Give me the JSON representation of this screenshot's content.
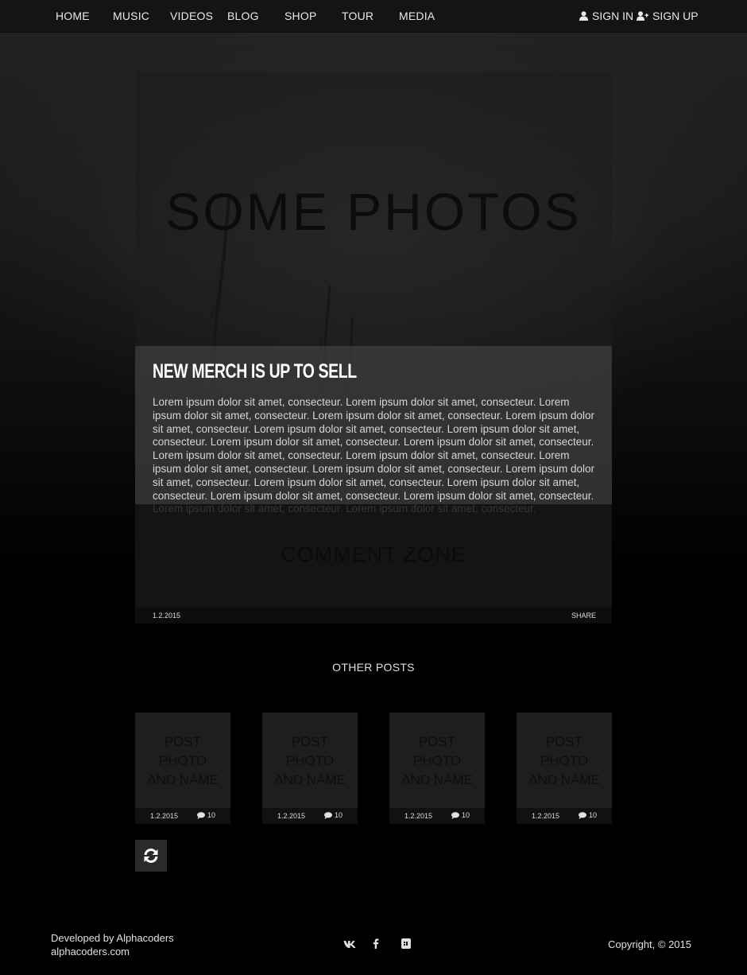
{
  "nav": {
    "items": [
      "HOME",
      "MUSIC",
      "VIDEOS",
      "BLOG",
      "SHOP",
      "TOUR",
      "MEDIA"
    ],
    "sign_in": "SIGN IN",
    "sign_up": "SIGN UP"
  },
  "post": {
    "hero_title": "SOME PHOTOS",
    "title": "NEW MERCH IS UP TO SELL",
    "body": "Lorem ipsum dolor sit amet, consecteur. Lorem ipsum dolor sit amet, consecteur. Lorem ipsum dolor sit amet, consecteur. Lorem ipsum dolor sit amet, consecteur. Lorem ipsum dolor sit amet, consecteur. Lorem ipsum dolor sit amet, consecteur. Lorem ipsum dolor sit amet, consecteur. Lorem ipsum dolor sit amet, consecteur. Lorem ipsum dolor sit amet, consecteur. Lorem ipsum dolor sit amet, consecteur. Lorem ipsum dolor sit amet, consecteur. Lorem ipsum dolor sit amet, consecteur. Lorem ipsum dolor sit amet, consecteur. Lorem ipsum dolor sit amet, consecteur. Lorem ipsum dolor sit amet, consecteur. Lorem ipsum dolor sit amet, consecteur. Lorem ipsum dolor sit amet, consecteur. Lorem ipsum dolor sit amet, consecteur. Lorem ipsum dolor sit amet, consecteur. Lorem ipsum dolor sit amet, consecteur.",
    "comment_zone": "COMMENT ZONE",
    "date": "1.2.2015",
    "share": "SHARE"
  },
  "other_posts": {
    "title": "OTHER POSTS",
    "cards": [
      {
        "placeholder_lines": [
          "POST",
          "PHOTO",
          "AND NAME"
        ],
        "date": "1.2.2015",
        "comments": "10"
      },
      {
        "placeholder_lines": [
          "POST",
          "PHOTO",
          "AND NAME"
        ],
        "date": "1.2.2015",
        "comments": "10"
      },
      {
        "placeholder_lines": [
          "POST",
          "PHOTO",
          "AND NAME"
        ],
        "date": "1.2.2015",
        "comments": "10"
      },
      {
        "placeholder_lines": [
          "POST",
          "PHOTO",
          "AND NAME"
        ],
        "date": "1.2.2015",
        "comments": "10"
      }
    ]
  },
  "icons": {
    "sign_in": "user-icon",
    "sign_up": "user-plus-icon",
    "comments": "comment-icon",
    "refresh": "refresh-icon",
    "social": [
      "vk-icon",
      "facebook-icon",
      "lastfm-icon"
    ]
  },
  "footer": {
    "developer": "Developed by Alphacoders",
    "site": "alphacoders.com",
    "copyright": "Copyright, © 2015"
  },
  "colors": {
    "background": "#000000",
    "nav_bar": "#141414",
    "excerpt_panel": "#3e3e3e",
    "text": "#e0e0e0"
  }
}
